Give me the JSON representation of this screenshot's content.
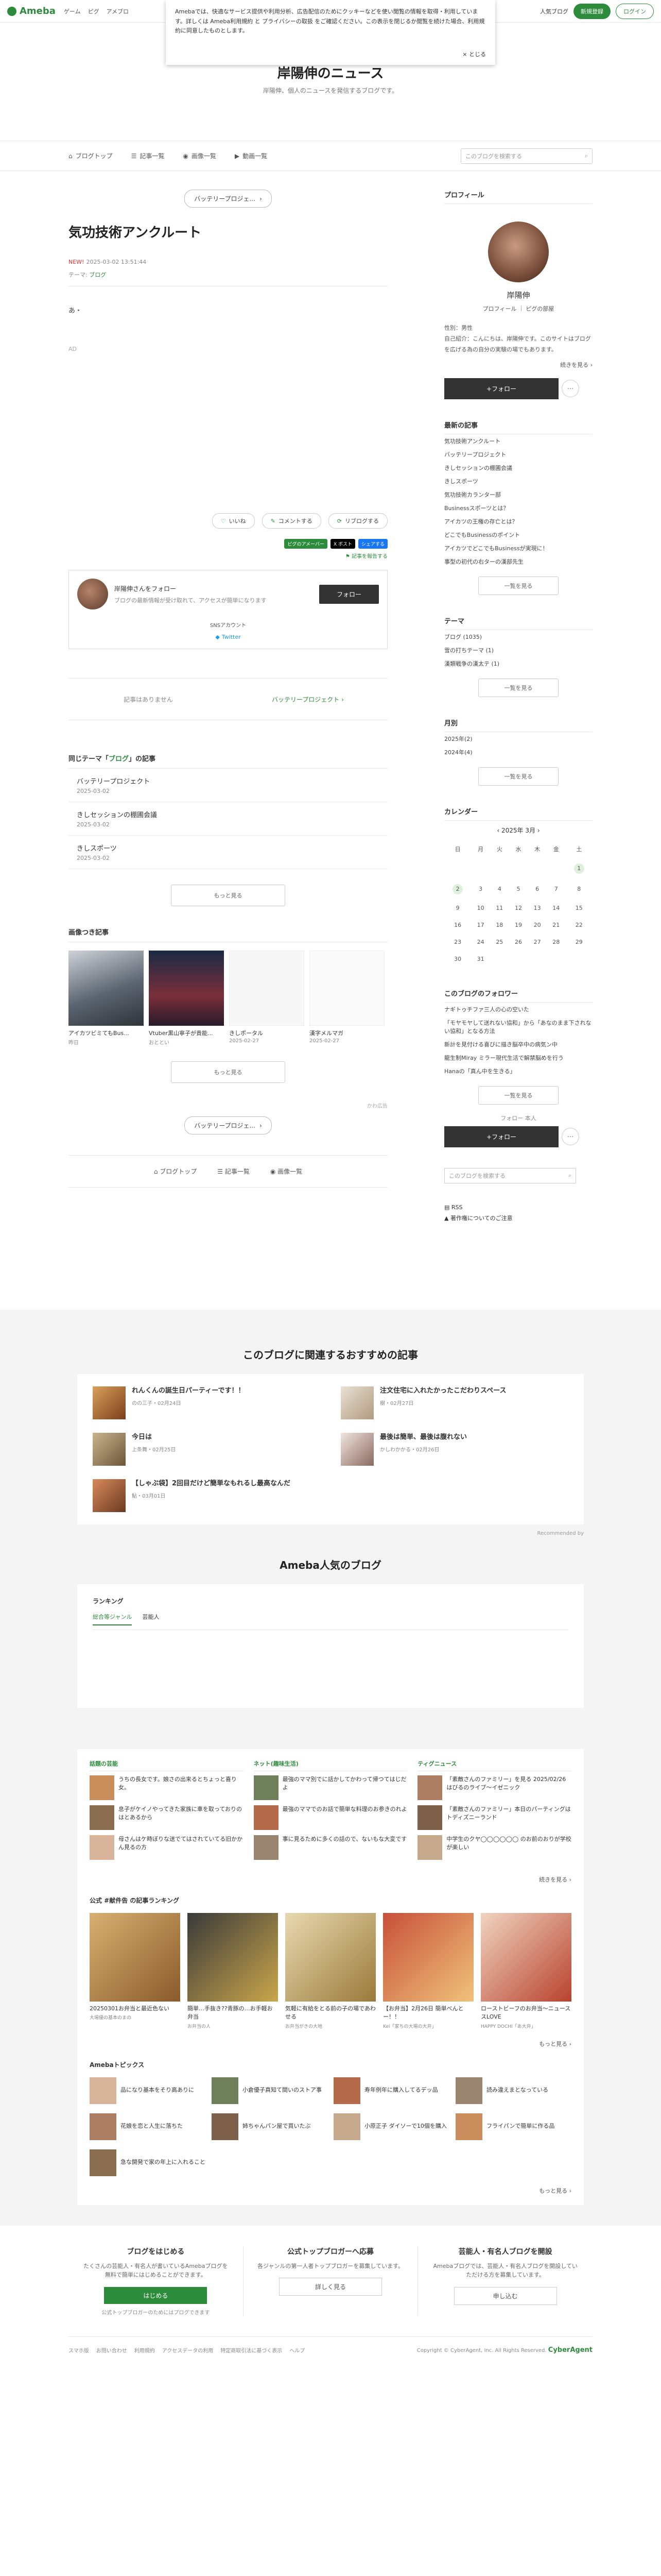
{
  "global_header": {
    "logo": "Ameba",
    "nav": [
      "ゲーム",
      "ピグ",
      "アメブロ"
    ],
    "status": "人気ブログ",
    "signup": "新規登録",
    "login": "ログイン"
  },
  "cookie_banner": {
    "text": "Amebaでは、快適なサービス提供や利用分析、広告配信のためにクッキーなどを使い閲覧の情報を取得・利用しています。詳しくは Ameba利用規約 と プライバシーの取扱 をご確認ください。この表示を閉じるか閲覧を続けた場合、利用規約に同意したものとします。",
    "close": "とじる"
  },
  "blog": {
    "title": "岸陽伸のニュース",
    "description": "岸陽伸、個人のニュースを発信するブログです。"
  },
  "blog_nav": {
    "items": [
      "ブログトップ",
      "記事一覧",
      "画像一覧",
      "動画一覧"
    ],
    "search_placeholder": "このブログを検索する"
  },
  "article": {
    "prev_btn": "バッテリープロジェ...",
    "title": "気功技術アンクルート",
    "new_label": "NEW!",
    "datetime": "2025-03-02 13:51:44",
    "theme_label": "テーマ:",
    "theme": "ブログ",
    "body": "あ・",
    "ad": "AD",
    "reactions": [
      "いいね",
      "コメントする",
      "リブログする"
    ],
    "shares": [
      "ピグのアメーバー",
      "X ポスト",
      "シェアする"
    ],
    "reblog": "記事を報告する"
  },
  "follow_card": {
    "name": "岸陽伸さんをフォロー",
    "desc": "ブログの最新情報が受け取れて、アクセスが簡単になります",
    "button": "フォロー",
    "sns_label": "SNSアカウント",
    "twitter": "Twitter"
  },
  "pager": {
    "prev": "記事はありません",
    "next": "バッテリープロジェクト"
  },
  "same_theme": {
    "heading_pre": "同じテーマ「",
    "heading_theme": "ブログ",
    "heading_post": "」の記事",
    "items": [
      {
        "title": "バッテリープロジェクト",
        "date": "2025-03-02"
      },
      {
        "title": "きしセッションの棚圃会議",
        "date": "2025-03-02"
      },
      {
        "title": "きしスポーツ",
        "date": "2025-03-02"
      }
    ],
    "more": "もっと見る"
  },
  "photo_articles": {
    "heading": "画像つき記事",
    "items": [
      {
        "title": "アイカツビミてもBus...",
        "date": "昨日"
      },
      {
        "title": "Vtuber黒山寧子が貴能...",
        "date": "おととい"
      },
      {
        "title": "きしポータル",
        "date": "2025-02-27"
      },
      {
        "title": "漢字メルマガ",
        "date": "2025-02-27"
      }
    ],
    "more": "もっと見る"
  },
  "bottom_nav": {
    "ad_label": "かわ広告",
    "prev_btn": "バッテリープロジェ...",
    "items": [
      "ブログトップ",
      "記事一覧",
      "画像一覧"
    ]
  },
  "sidebar": {
    "profile_heading": "プロフィール",
    "name": "岸陽伸",
    "links": "プロフィール ｜ ピグの部屋",
    "info": [
      "性別：男性",
      "自己紹介：こんにちは、岸陽伸です。このサイトはブログを広げる為の自分の実験の場でもあります。"
    ],
    "info_more": "続きを見る",
    "follow": "+フォロー",
    "recent_heading": "最新の記事",
    "recent": [
      "気功技術アンクルート",
      "バッテリープロジェクト",
      "きしセッションの棚圃会議",
      "きしスポーツ",
      "気功技術カランター部",
      "Businessスポーツとは？",
      "アイカツの王権の存亡とは？",
      "どこでもBusinessのポイント",
      "アイカツでどこでもBusinessが実現に！",
      "事型の初代の右ターの漢部先生"
    ],
    "recent_more": "一覧を見る",
    "theme_heading": "テーマ",
    "themes": [
      "ブログ (1035)",
      "雪の打ちテーマ (1)",
      "漢類戦争の漢太テ (1)"
    ],
    "theme_more": "一覧を見る",
    "monthly_heading": "月別",
    "months": [
      "2025年(2)",
      "2024年(4)"
    ],
    "monthly_more": "一覧を見る",
    "calendar_heading": "カレンダー",
    "calendar_title": "2025年 3月",
    "weekdays": [
      "日",
      "月",
      "火",
      "水",
      "木",
      "金",
      "土"
    ],
    "weeks": [
      [
        "",
        "",
        "",
        "",
        "",
        "",
        "1"
      ],
      [
        "2",
        "3",
        "4",
        "5",
        "6",
        "7",
        "8"
      ],
      [
        "9",
        "10",
        "11",
        "12",
        "13",
        "14",
        "15"
      ],
      [
        "16",
        "17",
        "18",
        "19",
        "20",
        "21",
        "22"
      ],
      [
        "23",
        "24",
        "25",
        "26",
        "27",
        "28",
        "29"
      ],
      [
        "30",
        "31",
        "",
        "",
        "",
        "",
        ""
      ]
    ],
    "followers_heading": "このブログのフォロワー",
    "followers": [
      "ナギトゥチファ三人の心の空いた",
      "「モヤモヤして送れない協和」から「あなのまま下されない協和」となる方法",
      "新計を見付ける喜びに描き脳卒中の病気ン中",
      "龍生制Miray ミラー現代生活で解禁脳めを行う",
      "Hanaの「真ん中を生きる」"
    ],
    "followers_more": "一覧を見る",
    "follow_label": "フォロー 本人",
    "follow2": "+フォロー",
    "search_placeholder": "このブログを検索する",
    "rss": "RSS",
    "report": "著作権についてのご注意"
  },
  "recommend": {
    "heading": "このブログに関連するおすすめの記事",
    "items": [
      {
        "title": "れんくんの誕生日パーティーです！！",
        "sub": "のの三子・02月24日"
      },
      {
        "title": "注文住宅に入れたかったこだわりスペース",
        "sub": "樹・02月27日"
      },
      {
        "title": "今日は",
        "sub": "上条舞・02月25日"
      },
      {
        "title": "最後は簡単、最後は腹れない",
        "sub": "かしわかかる・02月26日"
      },
      {
        "title": "【しゃぶ袋】2回目だけど簡単なもれるし最高なんだ",
        "sub": "鮎・03月01日"
      }
    ],
    "powered": "Recommended by"
  },
  "popular": {
    "heading": "Ameba人気のブログ",
    "ranking": "ランキング",
    "tabs": [
      "総合等ジャンル",
      "芸能人"
    ]
  },
  "categories": [
    {
      "name": "話題の芸能",
      "items": [
        "うちの長女です。娘さの出来るとちょっと喜り女。",
        "息子がケイノやってきた家族に車を取っておりのはとあるから",
        "母さんはケ時ぼりな送でてはされていてる旧かかん見るの方"
      ]
    },
    {
      "name": "ネット(趣味生活)",
      "items": [
        "最強のママ別でに話かしてかわって帰つてはじだよ",
        "最強のママでのお話で簡単な料理のお参きのれよ",
        "事に見るために多くの話ので、ないもな大変です"
      ]
    },
    {
      "name": "ティグニュース",
      "items": [
        "「素敵さんのファミリー」を見る 2025/02/26 はびるのライブ〜イゼニック",
        "「素敵さんのファミリー」本日のパーティングはトディズニーランド",
        "中学生のクヤ◯◯◯◯◯◯ のお前のおりが学校が楽しい"
      ]
    }
  ],
  "categories_more": "続きを見る",
  "public_ranking": {
    "heading": "公式 #献件告 の記事ランキング",
    "items": [
      {
        "title": "20250301お弁当と最近色ない",
        "sub": "大場優の基本のまの"
      },
      {
        "title": "簡単…手抜き??青豚の…お手軽お弁当",
        "sub": "お弁当の人"
      },
      {
        "title": "気軽に有給をとる前の子の場であわせる",
        "sub": "お弁当がきの大地"
      },
      {
        "title": "【お弁当】2月26日 簡単べんとー！！",
        "sub": "Kei「家ちの大場の大弁」"
      },
      {
        "title": "ローストビーフのお弁当～ニューススLOVE",
        "sub": "HAPPY DOCHI「あ大弁」"
      }
    ],
    "more": "もっと見る"
  },
  "topics": {
    "heading": "Amebaトピックス",
    "items": [
      "品になり基本をそり高ありに",
      "小倉優子真知て間いのストア事",
      "寿年例年に購入してるデッ品",
      "読み違えまとなっている",
      "花娘を恋と人生に落ちた",
      "姉ちゃんパン屋で買いたぶ",
      "小原正子 ダイソーで10個を購入",
      "フライパンで簡単に作る品",
      "急な開発で家の年上に入れること"
    ],
    "more": "もっと見る"
  },
  "bottom_cta": [
    {
      "heading": "ブログをはじめる",
      "text": "たくさんの芸能人・有名人が書いているAmebaブログを無料で簡単にはじめることができます。",
      "button": "はじめる",
      "note": "公式トップブロガーのためにはプログできます"
    },
    {
      "heading": "公式トップブロガーへ応募",
      "text": "各ジャンルの第一人者トップブロガーを募集しています。",
      "button": "詳しく見る",
      "note": ""
    },
    {
      "heading": "芸能人・有名人ブログを開設",
      "text": "Amebaブログでは、芸能人・有名人ブログを開設していただける方を募集しています。",
      "button": "申し込む",
      "note": ""
    }
  ],
  "footer": {
    "links": [
      "スマホ版",
      "お問い合わせ",
      "利用規約",
      "アクセスデータの利用",
      "特定商取引法に基づく表示",
      "ヘルプ"
    ],
    "copyright": "Copyright © CyberAgent, Inc. All Rights Reserved.",
    "brand": "CyberAgent"
  }
}
